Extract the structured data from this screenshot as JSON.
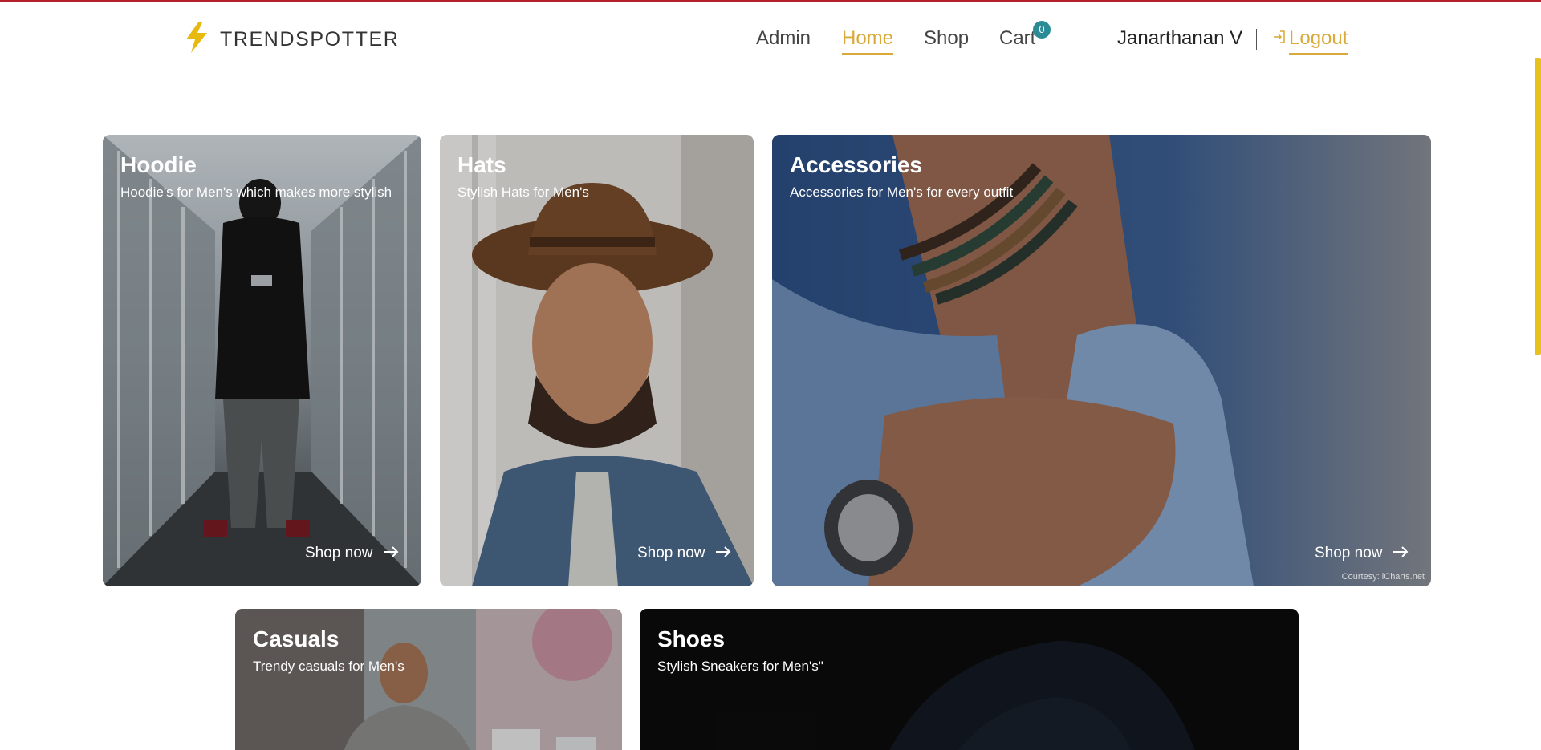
{
  "brand": {
    "name": "TRENDSPOTTER",
    "icon": "lightning-bolt-icon",
    "color": "#e8b90f"
  },
  "nav": {
    "items": [
      {
        "label": "Admin",
        "active": false
      },
      {
        "label": "Home",
        "active": true
      },
      {
        "label": "Shop",
        "active": false
      },
      {
        "label": "Cart",
        "active": false
      }
    ],
    "cart_count": "0"
  },
  "user": {
    "name": "Janarthanan V",
    "logout_label": "Logout",
    "logout_icon": "login-arrow-icon"
  },
  "colors": {
    "accent": "#d9a93a",
    "badge": "#2b8c95",
    "scrollbar": "#e8c21c"
  },
  "categories": [
    {
      "title": "Hoodie",
      "subtitle": "Hoodie's for Men's which makes more stylish",
      "cta": "Shop now"
    },
    {
      "title": "Hats",
      "subtitle": "Stylish Hats for Men's",
      "cta": "Shop now"
    },
    {
      "title": "Accessories",
      "subtitle": "Accessories for Men's for every outfit",
      "cta": "Shop now",
      "courtesy": "Courtesy: iCharts.net"
    },
    {
      "title": "Casuals",
      "subtitle": "Trendy casuals for Men's"
    },
    {
      "title": "Shoes",
      "subtitle": "Stylish Sneakers for Men's\""
    }
  ]
}
